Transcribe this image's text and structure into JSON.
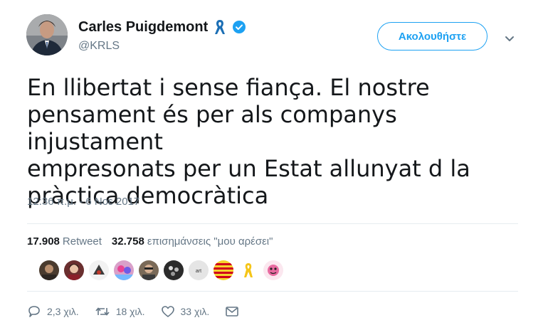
{
  "author": {
    "display_name": "Carles Puigdemont",
    "handle": "@KRLS",
    "avatar_icon": "profile-photo",
    "badges": [
      "yellow-ribbon-icon",
      "verified-icon"
    ]
  },
  "follow_button_label": "Ακολουθήστε",
  "tweet": {
    "text": "En llibertat i sense fiança. El nostre\npensament és per als companys injustament\nempresonats per un Estat allunyat d la\npràctica democràtica",
    "timestamp": "12:36 π.μ. - 6 Νοε 2017"
  },
  "stats": {
    "retweets_count": "17.908",
    "retweets_label": "Retweet",
    "likes_count": "32.758",
    "likes_label": "επισημάνσεις \"μου αρέσει\""
  },
  "likers": [
    {
      "icon": "liker-avatar-1"
    },
    {
      "icon": "liker-avatar-2"
    },
    {
      "icon": "liker-avatar-3"
    },
    {
      "icon": "liker-avatar-4"
    },
    {
      "icon": "liker-avatar-5"
    },
    {
      "icon": "liker-avatar-6"
    },
    {
      "icon": "liker-avatar-7"
    },
    {
      "icon": "liker-avatar-8"
    },
    {
      "icon": "liker-avatar-9"
    },
    {
      "icon": "liker-avatar-10"
    }
  ],
  "actions": {
    "replies": "2,3 χιλ.",
    "retweets": "18 χιλ.",
    "likes": "33 χιλ."
  },
  "colors": {
    "accent": "#1da1f2",
    "muted": "#657786",
    "ribbon": "#f5c518"
  }
}
